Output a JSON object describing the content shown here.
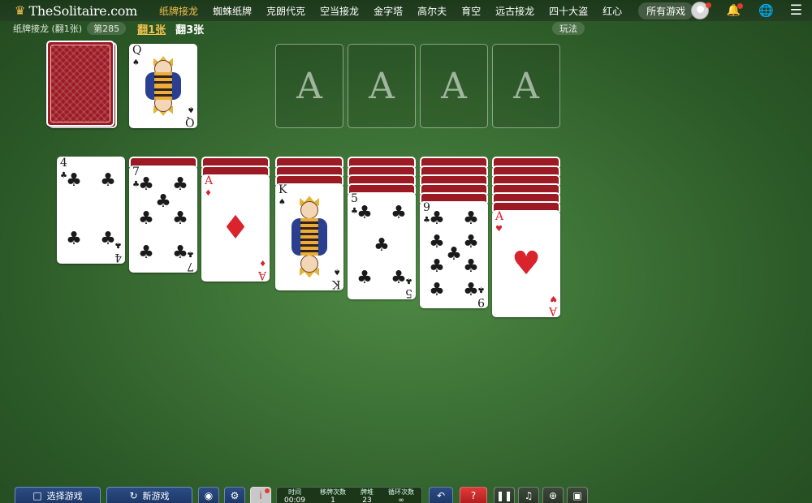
{
  "header": {
    "logo_text": "TheSolitaire.com",
    "nav": [
      {
        "label": "纸牌接龙",
        "active": true
      },
      {
        "label": "蜘蛛纸牌",
        "active": false
      },
      {
        "label": "克朗代克",
        "active": false
      },
      {
        "label": "空当接龙",
        "active": false
      },
      {
        "label": "金字塔",
        "active": false
      },
      {
        "label": "高尔夫",
        "active": false
      },
      {
        "label": "育空",
        "active": false
      },
      {
        "label": "远古接龙",
        "active": false
      },
      {
        "label": "四十大盗",
        "active": false
      },
      {
        "label": "红心",
        "active": false
      }
    ],
    "all_games": "所有游戏"
  },
  "subbar": {
    "game_name": "纸牌接龙 (翻1张)",
    "game_number": "第285",
    "draw1": "翻1张",
    "draw3": "翻3张",
    "rules": "玩法"
  },
  "waste": {
    "rank": "Q",
    "suit": "♠",
    "color": "black"
  },
  "foundations": [
    "A",
    "A",
    "A",
    "A"
  ],
  "tableau": [
    {
      "hidden": 0,
      "rank": "4",
      "suit": "♣",
      "color": "black"
    },
    {
      "hidden": 1,
      "rank": "7",
      "suit": "♣",
      "color": "black"
    },
    {
      "hidden": 2,
      "rank": "A",
      "suit": "♦",
      "color": "red"
    },
    {
      "hidden": 3,
      "rank": "K",
      "suit": "♠",
      "color": "black"
    },
    {
      "hidden": 4,
      "rank": "5",
      "suit": "♣",
      "color": "black"
    },
    {
      "hidden": 5,
      "rank": "9",
      "suit": "♣",
      "color": "black"
    },
    {
      "hidden": 6,
      "rank": "A",
      "suit": "♥",
      "color": "red"
    }
  ],
  "bottom": {
    "select_game": "选择游戏",
    "new_game": "新游戏",
    "stats": {
      "time_label": "时间",
      "time_value": "00:09",
      "moves_label": "移牌次数",
      "moves_value": "1",
      "stock_label": "牌堆",
      "stock_value": "23",
      "cycles_label": "循环次数",
      "cycles_value": "∞"
    }
  }
}
